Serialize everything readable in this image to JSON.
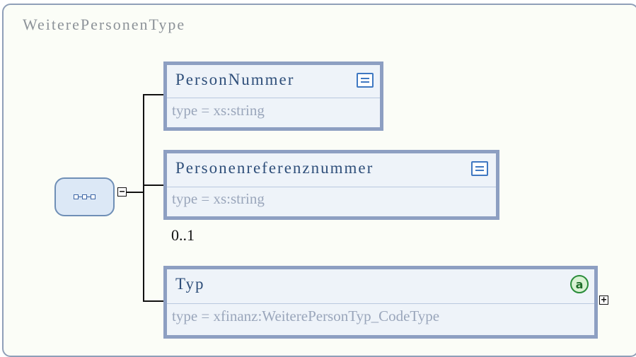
{
  "diagram": {
    "title": "WeiterePersonenType",
    "sequence_icon": "sequence-icon",
    "collapse_symbol": "−",
    "expand_symbol": "+",
    "elements": [
      {
        "name": "PersonNummer",
        "type": "type = xs:string",
        "badge": "simple-type-icon",
        "occurs": ""
      },
      {
        "name": "Personenreferenznummer",
        "type": "type = xs:string",
        "badge": "simple-type-icon",
        "occurs": "0..1"
      },
      {
        "name": "Typ",
        "type": "type = xfinanz:WeiterePersonTyp_CodeType",
        "badge": "attributes-icon",
        "badge_text": "a",
        "occurs": ""
      }
    ]
  },
  "colors": {
    "frame_border": "#8f9fb8",
    "element_border": "#8d9fc2",
    "element_fill": "#eef3f9",
    "name_text": "#2f4f7a",
    "type_text": "#9aa6bb"
  }
}
